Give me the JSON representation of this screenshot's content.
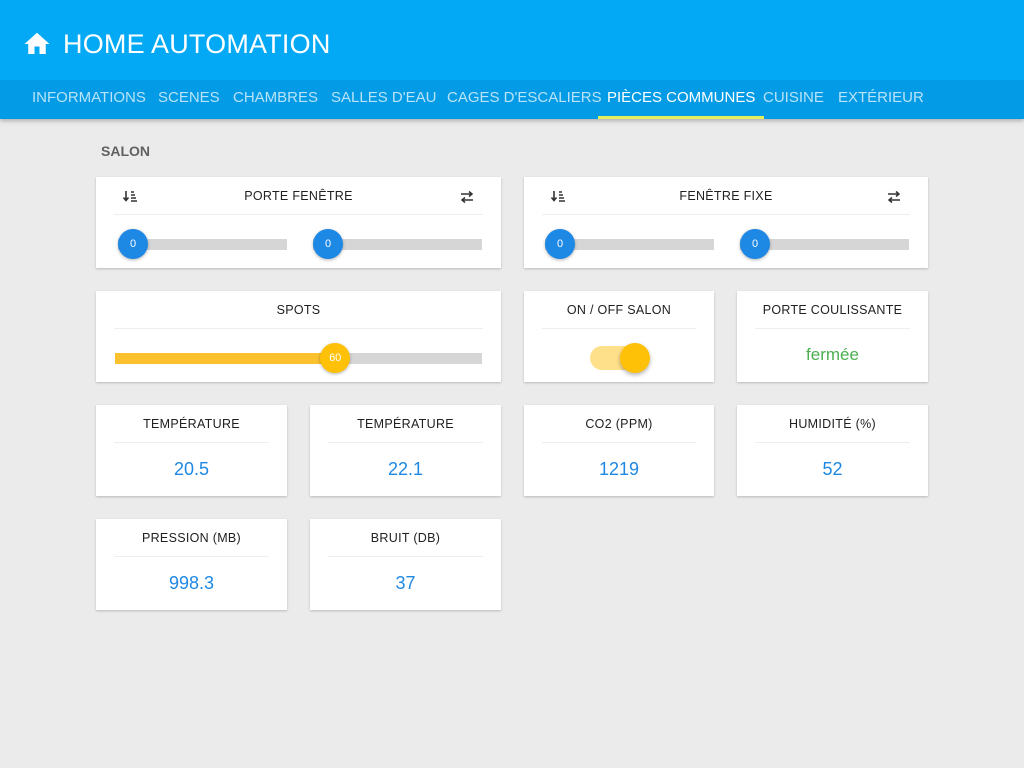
{
  "app": {
    "title": "HOME AUTOMATION",
    "home_icon": "home-icon"
  },
  "tabs": [
    {
      "label": "INFORMATIONS",
      "active": false
    },
    {
      "label": "SCENES",
      "active": false
    },
    {
      "label": "CHAMBRES",
      "active": false
    },
    {
      "label": "SALLES D'EAU",
      "active": false
    },
    {
      "label": "CAGES D'ESCALIERS",
      "active": false
    },
    {
      "label": "PIÈCES COMMUNES",
      "active": true
    },
    {
      "label": "CUISINE",
      "active": false
    },
    {
      "label": "EXTÉRIEUR",
      "active": false
    }
  ],
  "section": {
    "title": "SALON"
  },
  "shutters": [
    {
      "title": "PORTE FENÊTRE",
      "left_icon": "sort-descending-icon",
      "right_icon": "swap-arrows-icon",
      "slider1": 0,
      "slider2": 0
    },
    {
      "title": "FENÊTRE FIXE",
      "left_icon": "sort-descending-icon",
      "right_icon": "swap-arrows-icon",
      "slider1": 0,
      "slider2": 0
    }
  ],
  "spots": {
    "title": "SPOTS",
    "value": 60,
    "max": 100
  },
  "onoff": {
    "title": "ON / OFF SALON",
    "on": true
  },
  "door": {
    "title": "PORTE COULISSANTE",
    "state": "fermée"
  },
  "sensors": [
    {
      "title": "TEMPÉRATURE",
      "value": "20.5"
    },
    {
      "title": "TEMPÉRATURE",
      "value": "22.1"
    },
    {
      "title": "CO2 (PPM)",
      "value": "1219"
    },
    {
      "title": "HUMIDITÉ (%)",
      "value": "52"
    },
    {
      "title": "PRESSION (MB)",
      "value": "998.3"
    },
    {
      "title": "BRUIT (DB)",
      "value": "37"
    }
  ],
  "colors": {
    "header": "#03a9f4",
    "tabs": "#039be5",
    "tab_indicator": "#e2ef5b",
    "accent_blue": "#1e88e5",
    "accent_amber": "#ffc107",
    "state_green": "#4caf50",
    "background": "#ebebeb"
  }
}
